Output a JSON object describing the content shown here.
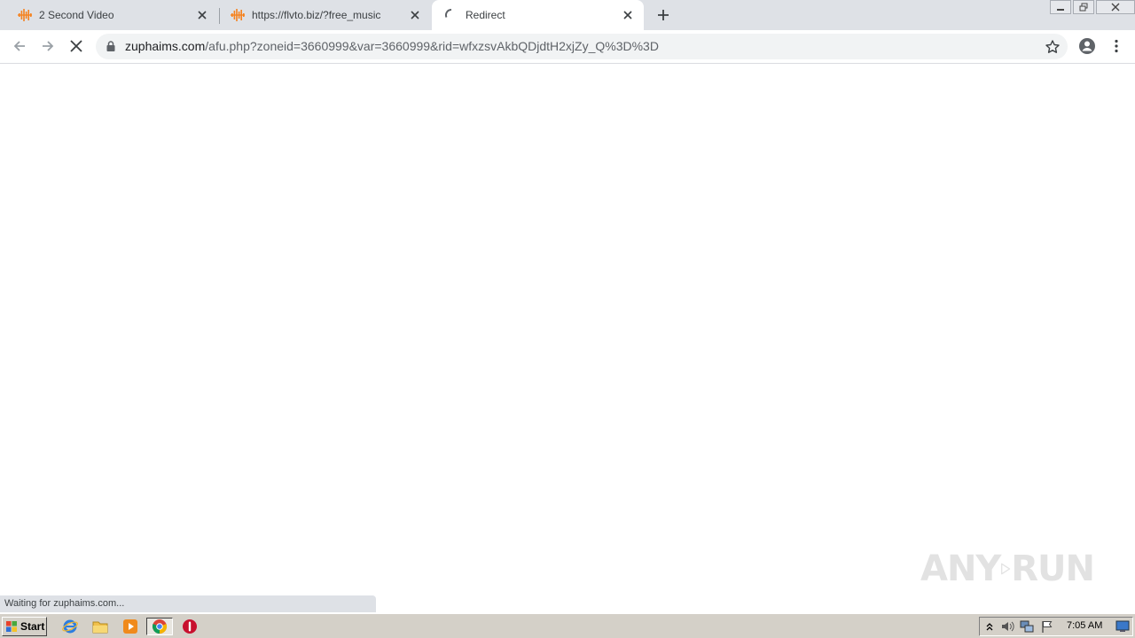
{
  "browser": {
    "tabs": [
      {
        "title": "2 Second Video",
        "favicon": "soundwave-icon",
        "active": false
      },
      {
        "title": "https://flvto.biz/?free_music",
        "favicon": "soundwave-icon",
        "active": false
      },
      {
        "title": "Redirect",
        "favicon": "loading-spinner-icon",
        "active": true
      }
    ],
    "address_bar": {
      "host": "zuphaims.com",
      "path": "/afu.php?zoneid=3660999&var=3660999&rid=wfxzsvAkbQDjdtH2xjZy_Q%3D%3D"
    },
    "status_text": "Waiting for zuphaims.com..."
  },
  "watermark": {
    "text_left": "ANY",
    "text_right": "RUN"
  },
  "taskbar": {
    "start_label": "Start",
    "clock": "7:05 AM"
  },
  "colors": {
    "tab_strip": "#dee1e6",
    "favicon_orange": "#f5821f",
    "omnibox_bg": "#f1f3f4",
    "taskbar": "#d4d0c8"
  }
}
